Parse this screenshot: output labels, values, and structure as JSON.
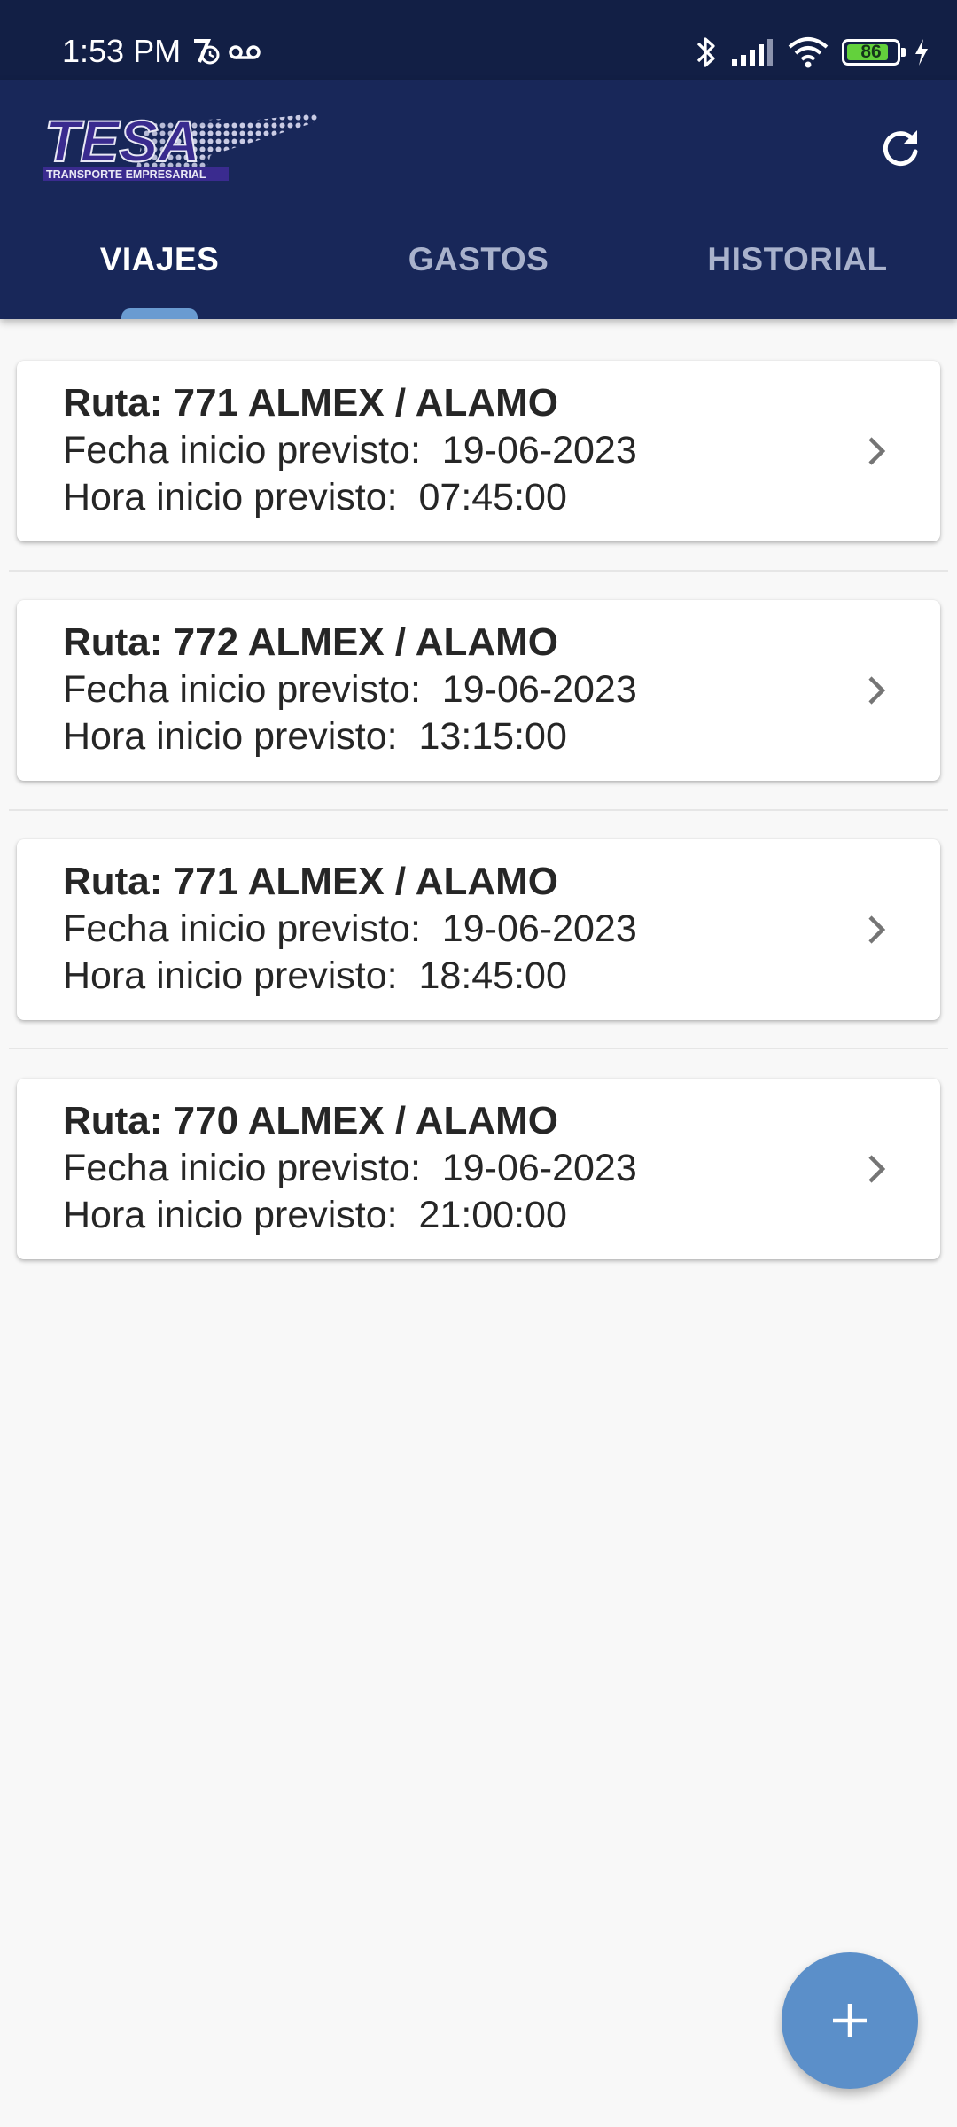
{
  "status_bar": {
    "time": "1:53 PM",
    "battery_level": "86",
    "battery_percent": 86,
    "icons": [
      "alarm-icon",
      "voicemail-icon",
      "bluetooth-icon",
      "signal-icon",
      "wifi-icon",
      "battery-icon",
      "charging-icon"
    ]
  },
  "app_bar": {
    "logo_text": "TESA",
    "logo_subtitle": "TRANSPORTE EMPRESARIAL",
    "refresh_icon": "refresh-icon"
  },
  "tabs": [
    {
      "label": "VIAJES",
      "active": true
    },
    {
      "label": "GASTOS",
      "active": false
    },
    {
      "label": "HISTORIAL",
      "active": false
    }
  ],
  "trips": [
    {
      "title": "Ruta: 771 ALMEX / ALAMO",
      "date_line": "Fecha inicio previsto:  19-06-2023",
      "time_line": "Hora inicio previsto:  07:45:00"
    },
    {
      "title": "Ruta: 772 ALMEX / ALAMO",
      "date_line": "Fecha inicio previsto:  19-06-2023",
      "time_line": "Hora inicio previsto:  13:15:00"
    },
    {
      "title": "Ruta: 771 ALMEX / ALAMO",
      "date_line": "Fecha inicio previsto:  19-06-2023",
      "time_line": "Hora inicio previsto:  18:45:00"
    },
    {
      "title": "Ruta: 770 ALMEX / ALAMO",
      "date_line": "Fecha inicio previsto:  19-06-2023",
      "time_line": "Hora inicio previsto:  21:00:00"
    }
  ],
  "fab": {
    "icon": "plus-icon"
  },
  "colors": {
    "app_bar": "#182759",
    "status_bar": "#121f45",
    "tab_indicator": "#6a9bd1",
    "fab": "#5b8fc9",
    "background": "#f8f8f8",
    "card": "#ffffff"
  }
}
